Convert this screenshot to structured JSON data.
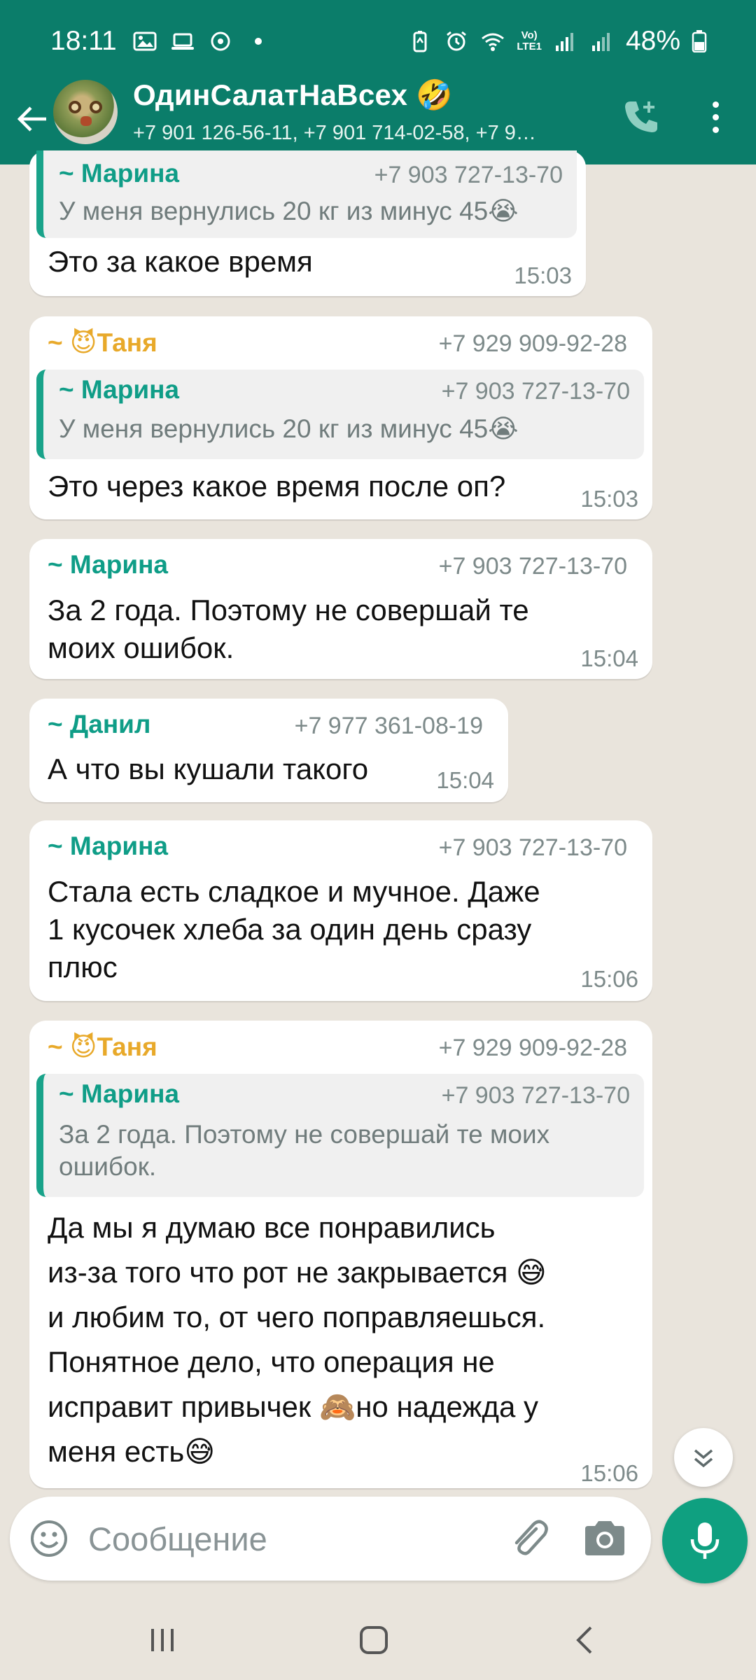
{
  "status_bar": {
    "time": "18:11",
    "battery": "48%",
    "net_label_top": "Vo)",
    "net_label_bottom": "LTE1",
    "icons": [
      "gallery-icon",
      "laptop-icon",
      "sync-icon",
      "dot-icon",
      "battery-saver-icon",
      "alarm-icon",
      "wifi-icon",
      "signal-icon",
      "battery-icon"
    ]
  },
  "header": {
    "title": "ОдинСалатНаВсех 🤣",
    "subtitle": "+7 901 126-56-11, +7 901 714-02-58, +7 9…",
    "accent_color": "#0b7d6a"
  },
  "messages": [
    {
      "quote": {
        "sender": "~ Марина",
        "phone": "+7 903 727-13-70",
        "text": "У меня вернулись 20 кг из минус 45😭"
      },
      "text": "Это за какое время",
      "time": "15:03"
    },
    {
      "sender": "~ 😈Таня",
      "phone": "+7 929 909-92-28",
      "quote": {
        "sender": "~ Марина",
        "phone": "+7 903 727-13-70",
        "text": "У меня вернулись 20 кг из минус 45😭"
      },
      "text": "Это через какое время после оп?",
      "time": "15:03"
    },
    {
      "sender": "~ Марина",
      "phone": "+7 903 727-13-70",
      "text_lines": [
        "За 2 года. Поэтому не совершай те",
        "моих ошибок."
      ],
      "time": "15:04"
    },
    {
      "sender": "~ Данил",
      "phone": "+7 977 361-08-19",
      "text": "А что вы кушали такого",
      "time": "15:04"
    },
    {
      "sender": "~ Марина",
      "phone": "+7 903 727-13-70",
      "text_lines": [
        "Стала есть сладкое и мучное. Даже",
        "1 кусочек хлеба  за один день сразу",
        "плюс"
      ],
      "time": "15:06"
    },
    {
      "sender": "~ 😈Таня",
      "phone": "+7 929 909-92-28",
      "quote": {
        "sender": "~ Марина",
        "phone": "+7 903 727-13-70",
        "text_lines": [
          "За 2 года. Поэтому не совершай те моих",
          "ошибок."
        ]
      },
      "text_lines": [
        "Да мы я думаю все понравились",
        "из-за того что рот не закрывается 😅",
        "и любим то, от чего поправляешься.",
        "Понятное дело, что операция не",
        "исправит привычек 🙈но надежда у",
        "меня есть😅"
      ],
      "time": "15:06"
    }
  ],
  "composer": {
    "placeholder": "Сообщение"
  }
}
